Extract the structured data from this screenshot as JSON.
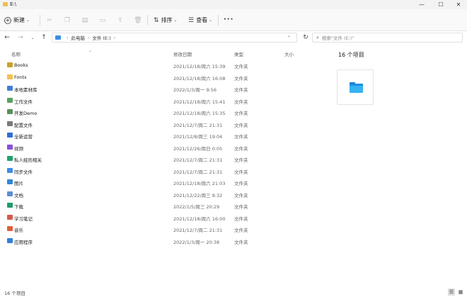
{
  "window": {
    "title": "E:\\",
    "minimize": "—",
    "maximize": "☐",
    "close": "✕"
  },
  "commandbar": {
    "new_label": "新建",
    "sort_label": "排序",
    "view_label": "查看",
    "more_label": "···",
    "tools": [
      "cut-icon",
      "copy-icon",
      "paste-icon",
      "rename-icon",
      "share-icon",
      "delete-icon"
    ]
  },
  "address": {
    "crumbs": [
      "此电脑",
      "文件 (E:)"
    ],
    "search_placeholder": "搜索\"文件 (E:)\""
  },
  "columns": {
    "name": "名称",
    "modified": "修改日期",
    "type": "类型",
    "size": "大小"
  },
  "files": [
    {
      "name": "Books",
      "date": "2021/12/18/周六 15:39",
      "type": "文件夹",
      "icon": "books-folder-icon",
      "color": "#c9a227"
    },
    {
      "name": "Fonts",
      "date": "2021/12/18/周六 16:08",
      "type": "文件夹",
      "icon": "folder-icon",
      "color": "#f2c24c"
    },
    {
      "name": "本地素材库",
      "date": "2022/1/3/周一 9:56",
      "type": "文件夹",
      "icon": "library-folder-icon",
      "color": "#3d7fd6"
    },
    {
      "name": "工作文件",
      "date": "2021/12/18/周六 15:41",
      "type": "文件夹",
      "icon": "work-folder-icon",
      "color": "#5aa05a"
    },
    {
      "name": "开发Demo",
      "date": "2021/12/18/周六 15:35",
      "type": "文件夹",
      "icon": "dev-folder-icon",
      "color": "#5a8f5a"
    },
    {
      "name": "配置文件",
      "date": "2021/12/7/周二 21:31",
      "type": "文件夹",
      "icon": "config-folder-icon",
      "color": "#7a7a7a"
    },
    {
      "name": "全新运营",
      "date": "2021/12/8/周三 19:04",
      "type": "文件夹",
      "icon": "ops-folder-icon",
      "color": "#2d6fd0"
    },
    {
      "name": "视频",
      "date": "2021/12/26/周日 0:05",
      "type": "文件夹",
      "icon": "video-folder-icon",
      "color": "#8a4fd6"
    },
    {
      "name": "私人经历相关",
      "date": "2021/12/7/周二 21:31",
      "type": "文件夹",
      "icon": "private-folder-icon",
      "color": "#1aa56a"
    },
    {
      "name": "同步文件",
      "date": "2021/12/7/周二 21:31",
      "type": "文件夹",
      "icon": "sync-folder-icon",
      "color": "#3a8ee6"
    },
    {
      "name": "图片",
      "date": "2021/12/18/周六 21:03",
      "type": "文件夹",
      "icon": "pictures-folder-icon",
      "color": "#2f86d9"
    },
    {
      "name": "文档",
      "date": "2021/12/22/周三 8:32",
      "type": "文件夹",
      "icon": "documents-folder-icon",
      "color": "#5b8fd6"
    },
    {
      "name": "下载",
      "date": "2022/1/5/周三 20:29",
      "type": "文件夹",
      "icon": "downloads-folder-icon",
      "color": "#1f9d6a"
    },
    {
      "name": "学习笔记",
      "date": "2021/12/18/周六 16:00",
      "type": "文件夹",
      "icon": "notes-folder-icon",
      "color": "#d65a4a"
    },
    {
      "name": "音乐",
      "date": "2021/12/7/周二 21:31",
      "type": "文件夹",
      "icon": "music-folder-icon",
      "color": "#e0603a"
    },
    {
      "name": "应用程序",
      "date": "2022/1/3/周一 20:38",
      "type": "文件夹",
      "icon": "apps-folder-icon",
      "color": "#2e7fd9"
    }
  ],
  "preview": {
    "title": "16 个项目"
  },
  "status": {
    "count": "16 个项目"
  }
}
